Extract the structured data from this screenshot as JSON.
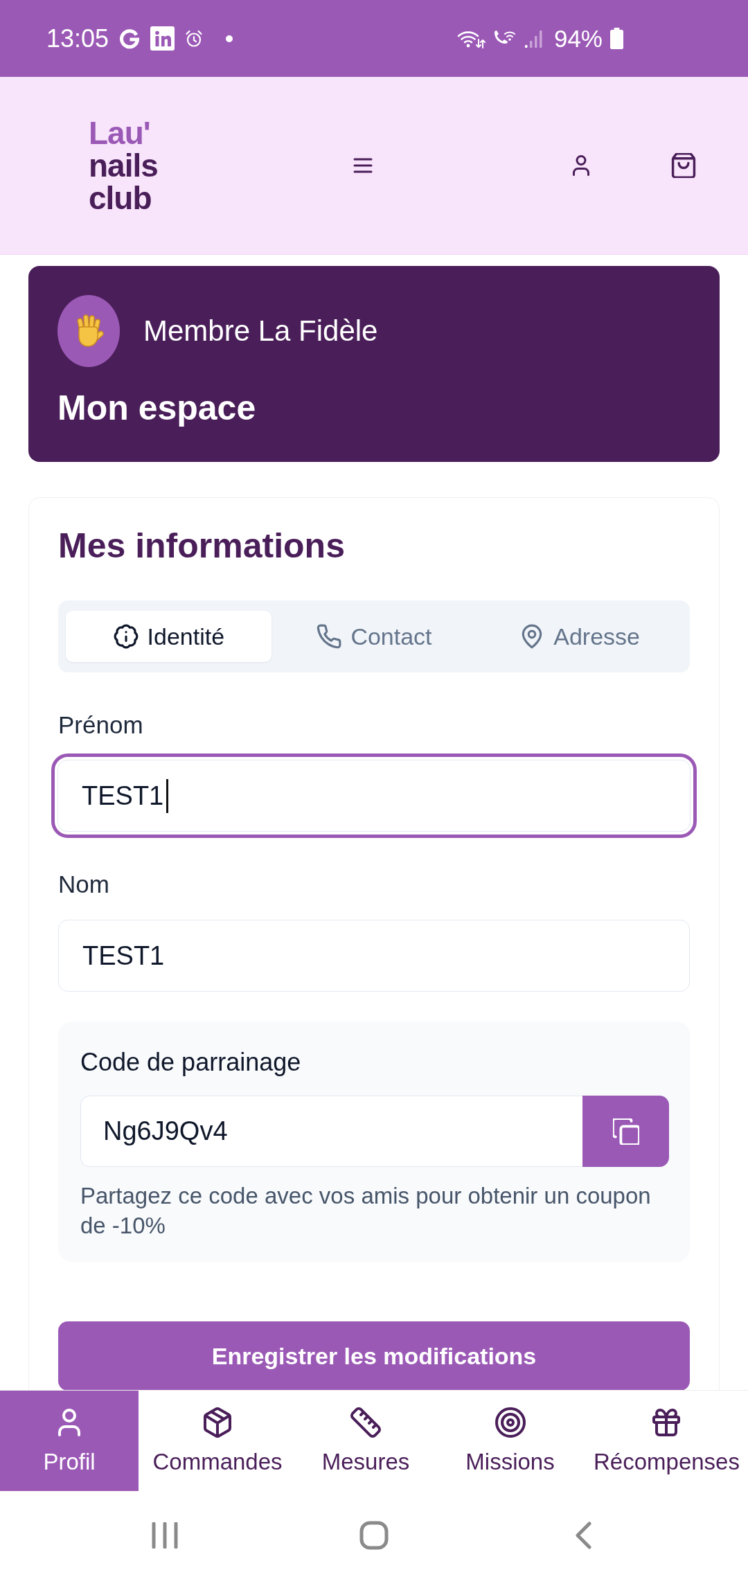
{
  "status_bar": {
    "time": "13:05",
    "battery": "94%"
  },
  "header": {
    "logo": [
      "Lau'",
      "nails",
      "club"
    ]
  },
  "member_card": {
    "badge": "Membre La Fidèle",
    "title": "Mon espace"
  },
  "info": {
    "title": "Mes informations",
    "tabs": [
      {
        "label": "Identité",
        "selected": true
      },
      {
        "label": "Contact",
        "selected": false
      },
      {
        "label": "Adresse",
        "selected": false
      }
    ],
    "fields": [
      {
        "label": "Prénom",
        "value": "TEST1",
        "focused": true
      },
      {
        "label": "Nom",
        "value": "TEST1",
        "focused": false
      }
    ],
    "referral": {
      "label": "Code de parrainage",
      "value": "Ng6J9Qv4",
      "help": "Partagez ce code avec vos amis pour obtenir un coupon de -10%"
    },
    "save_button": "Enregistrer les modifications"
  },
  "bottom_nav": [
    {
      "label": "Profil",
      "selected": true
    },
    {
      "label": "Commandes",
      "selected": false
    },
    {
      "label": "Mesures",
      "selected": false
    },
    {
      "label": "Missions",
      "selected": false
    },
    {
      "label": "Récompenses",
      "selected": false
    }
  ]
}
